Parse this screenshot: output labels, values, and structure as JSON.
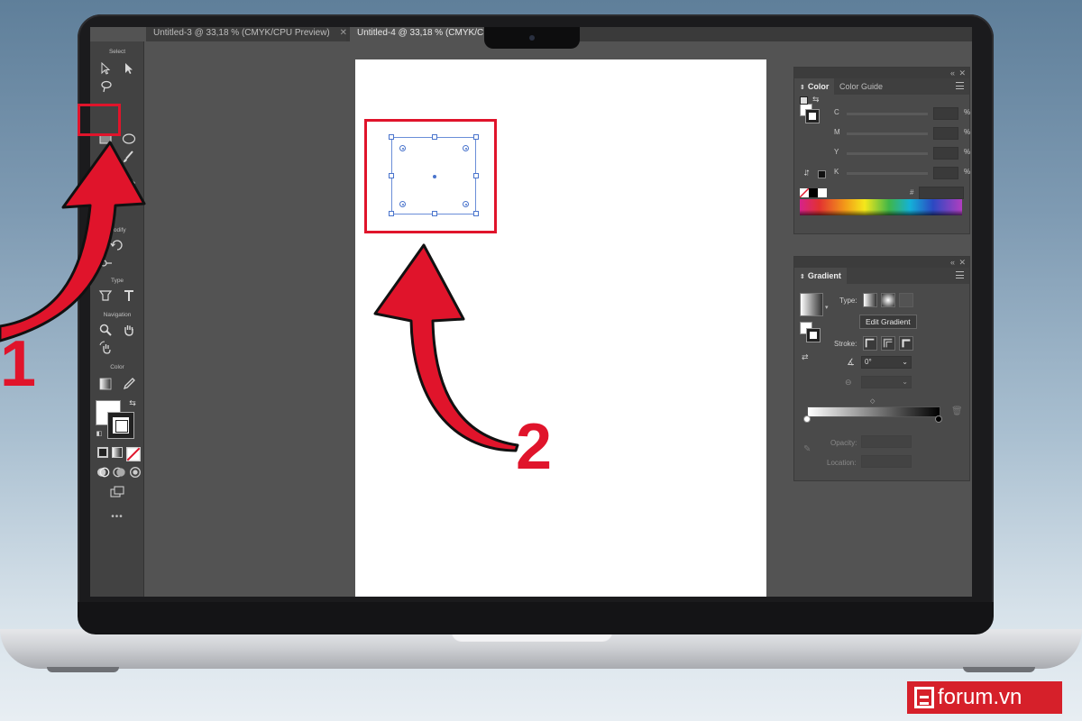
{
  "document_tabs": [
    {
      "label": "Untitled-3 @ 33,18 % (CMYK/CPU Preview)"
    },
    {
      "label": "Untitled-4 @ 33,18 % (CMYK/CP"
    }
  ],
  "toolbar": {
    "groups": {
      "select": "Select",
      "modify": "Modify",
      "type": "Type",
      "navigation": "Navigation",
      "color": "Color"
    },
    "more": "•••"
  },
  "color_panel": {
    "tabs": [
      "Color",
      "Color Guide"
    ],
    "channels": [
      "C",
      "M",
      "Y",
      "K"
    ],
    "percent_sign": "%",
    "hex_sign": "#"
  },
  "gradient_panel": {
    "title": "Gradient",
    "type_label": "Type:",
    "tooltip": "Edit Gradient",
    "stroke_label": "Stroke:",
    "angle_value": "0°",
    "opacity_label": "Opacity:",
    "location_label": "Location:"
  },
  "annotations": {
    "step1": "1",
    "step2": "2",
    "color": "#e0142b"
  },
  "logo": {
    "text": "forum.vn"
  }
}
